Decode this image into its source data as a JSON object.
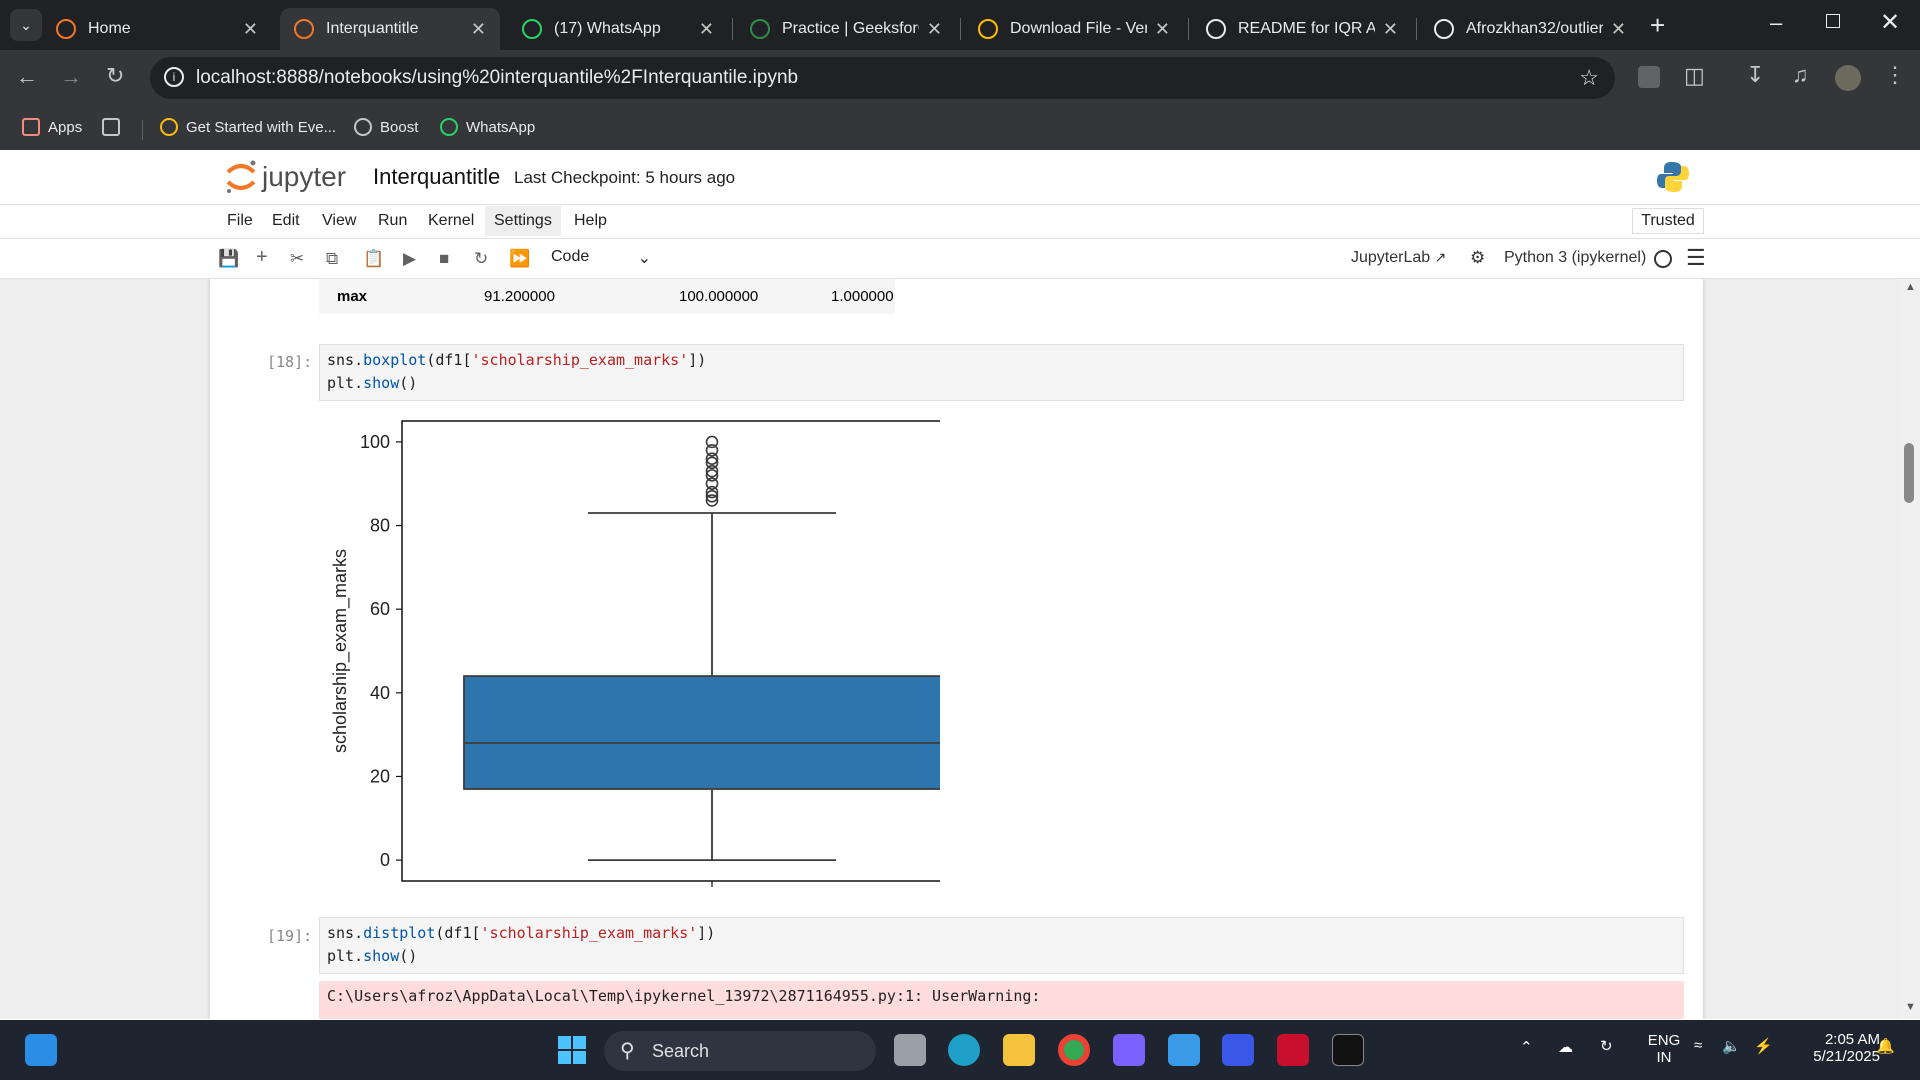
{
  "browser": {
    "tabs": [
      {
        "label": "Home",
        "icon": "jupyter-icon"
      },
      {
        "label": "Interquantitle",
        "icon": "notebook-icon",
        "active": true
      },
      {
        "label": "(17) WhatsApp",
        "icon": "whatsapp-icon"
      },
      {
        "label": "Practice | GeeksforGe",
        "icon": "geeksforgeeks-icon"
      },
      {
        "label": "Download File - Verti",
        "icon": "download-icon"
      },
      {
        "label": "README for IQR Ana",
        "icon": "openai-icon"
      },
      {
        "label": "Afrozkhan32/outlier",
        "icon": "github-icon"
      }
    ],
    "url": "localhost:8888/notebooks/using%20interquantile%2FInterquantile.ipynb",
    "bookmarks": [
      {
        "label": "Apps",
        "icon": "apps-grid-icon"
      },
      {
        "label": "",
        "icon": "tab-groups-icon"
      },
      {
        "label": "Get Started with Eve...",
        "icon": "google-cloud-icon"
      },
      {
        "label": "Boost",
        "icon": "boost-globe-icon"
      },
      {
        "label": "WhatsApp",
        "icon": "whatsapp-icon"
      }
    ]
  },
  "jupyter": {
    "logo_text": "jupyter",
    "notebook_title": "Interquantitle",
    "checkpoint": "Last Checkpoint: 5 hours ago",
    "trusted": "Trusted",
    "menu": [
      "File",
      "Edit",
      "View",
      "Run",
      "Kernel",
      "Settings",
      "Help"
    ],
    "cell_type": "Code",
    "jupyterlab_label": "JupyterLab",
    "kernel_label": "Python 3 (ipykernel)"
  },
  "notebook": {
    "table_row": {
      "label": "max",
      "values": [
        "91.200000",
        "100.000000",
        "1.000000"
      ]
    },
    "cell18": {
      "prompt": "[18]:",
      "line1_fn": "sns.",
      "line1_call": "boxplot",
      "line1_open": "(df1[",
      "line1_str": "'scholarship_exam_marks'",
      "line1_close": "])",
      "line2_obj": "plt.",
      "line2_call": "show",
      "line2_close": "()"
    },
    "cell19": {
      "prompt": "[19]:",
      "line1_fn": "sns.",
      "line1_call": "distplot",
      "line1_open": "(df1[",
      "line1_str": "'scholarship_exam_marks'",
      "line1_close": "])",
      "line2_obj": "plt.",
      "line2_call": "show",
      "line2_close": "()",
      "warning": "C:\\Users\\afroz\\AppData\\Local\\Temp\\ipykernel_13972\\2871164955.py:1: UserWarning:"
    }
  },
  "chart_data": {
    "type": "box",
    "ylabel": "scholarship_exam_marks",
    "ylim": [
      -5,
      105
    ],
    "yticks": [
      0,
      20,
      40,
      60,
      80,
      100
    ],
    "box": {
      "whisker_low": 0,
      "q1": 17,
      "median": 28,
      "q3": 44,
      "whisker_high": 83
    },
    "outliers": [
      86,
      87,
      88,
      90,
      92,
      93,
      95,
      96,
      98,
      100
    ],
    "color": "#2e75ad"
  },
  "taskbar": {
    "search_label": "Search",
    "lang_top": "ENG",
    "lang_bottom": "IN",
    "time": "2:05 AM",
    "date": "5/21/2025"
  }
}
